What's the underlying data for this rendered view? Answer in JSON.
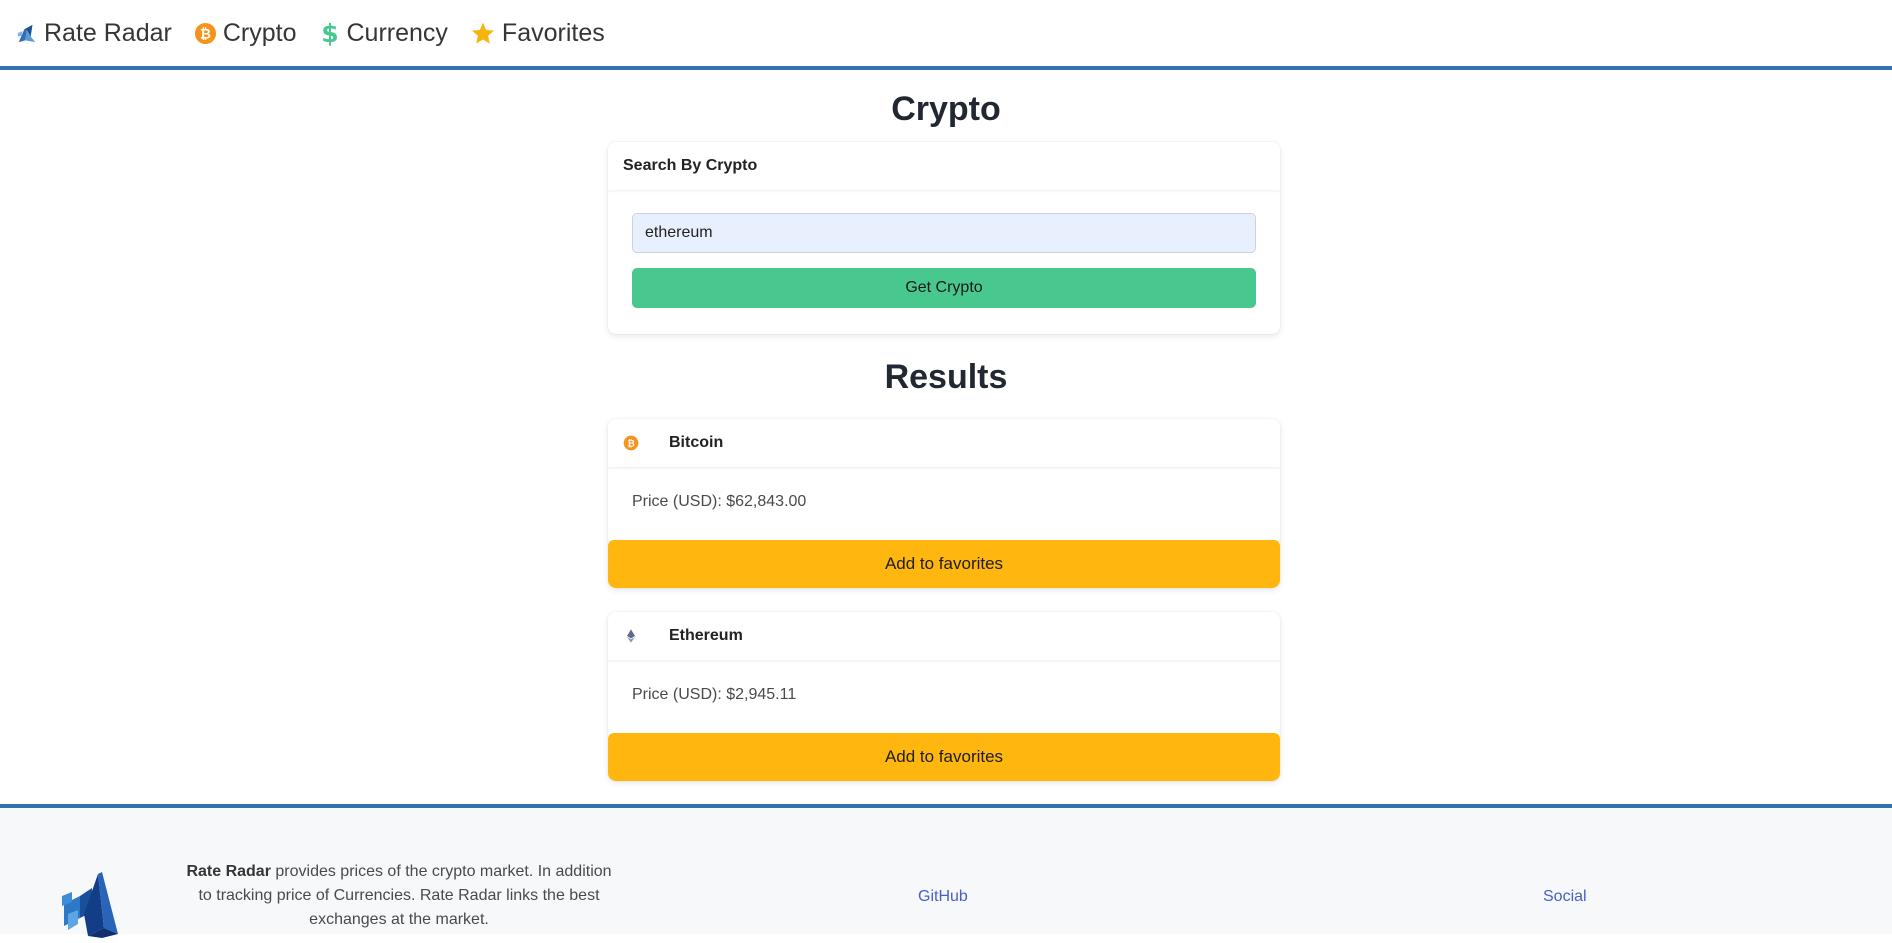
{
  "nav": {
    "brand": "Rate Radar",
    "items": [
      {
        "label": "Crypto",
        "icon": "bitcoin-icon"
      },
      {
        "label": "Currency",
        "icon": "dollar-icon"
      },
      {
        "label": "Favorites",
        "icon": "star-icon"
      }
    ]
  },
  "crypto_section": {
    "title": "Crypto",
    "search_card": {
      "header": "Search By Crypto",
      "input_value": "ethereum",
      "button_label": "Get Crypto"
    }
  },
  "results_section": {
    "title": "Results",
    "items": [
      {
        "name": "Bitcoin",
        "icon": "bitcoin-icon",
        "price_label": "Price (USD): $62,843.00",
        "button_label": "Add to favorites"
      },
      {
        "name": "Ethereum",
        "icon": "ethereum-icon",
        "price_label": "Price (USD): $2,945.11",
        "button_label": "Add to favorites"
      }
    ]
  },
  "footer": {
    "brand": "Rate Radar",
    "description": " provides prices of the crypto market. In addition to tracking price of Currencies. Rate Radar links the best exchanges at the market.",
    "links": [
      "GitHub",
      "Social"
    ]
  },
  "colors": {
    "accent_border": "#3273ae",
    "primary_button": "#48c78e",
    "favorite_button": "#ffb60f",
    "bitcoin_orange": "#f7931a",
    "dollar_green": "#48c78e",
    "star_yellow": "#f5b50b",
    "link_blue": "#485fc7"
  }
}
